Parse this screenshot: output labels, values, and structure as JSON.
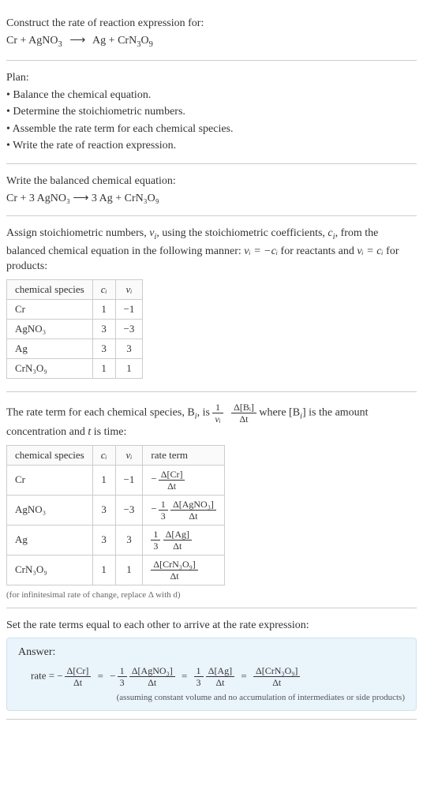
{
  "problem": {
    "title": "Construct the rate of reaction expression for:",
    "equation_lhs_1": "Cr",
    "equation_plus": "+",
    "equation_lhs_2": "AgNO",
    "equation_lhs_2_sub": "3",
    "arrow": "⟶",
    "equation_rhs_1": "Ag",
    "equation_rhs_2": "CrN",
    "equation_rhs_2_sub1": "3",
    "equation_rhs_2_mid": "O",
    "equation_rhs_2_sub2": "9"
  },
  "plan": {
    "heading": "Plan:",
    "items": [
      "• Balance the chemical equation.",
      "• Determine the stoichiometric numbers.",
      "• Assemble the rate term for each chemical species.",
      "• Write the rate of reaction expression."
    ]
  },
  "balanced": {
    "heading": "Write the balanced chemical equation:",
    "eq": "Cr + 3 AgNO₃ ⟶ 3 Ag + CrN₃O₉"
  },
  "assign": {
    "text_a": "Assign stoichiometric numbers, ",
    "nu": "ν",
    "sub_i": "i",
    "text_b": ", using the stoichiometric coefficients, ",
    "c": "c",
    "text_c": ", from the balanced chemical equation in the following manner: ",
    "rel1": "νᵢ = −cᵢ",
    "text_d": " for reactants and ",
    "rel2": "νᵢ = cᵢ",
    "text_e": " for products:"
  },
  "table1": {
    "headers": {
      "species": "chemical species",
      "ci": "cᵢ",
      "nui": "νᵢ"
    },
    "rows": [
      {
        "species": "Cr",
        "ci": "1",
        "nui": "−1"
      },
      {
        "species": "AgNO₃",
        "ci": "3",
        "nui": "−3"
      },
      {
        "species": "Ag",
        "ci": "3",
        "nui": "3"
      },
      {
        "species": "CrN₃O₉",
        "ci": "1",
        "nui": "1"
      }
    ]
  },
  "rateterm": {
    "text_a": "The rate term for each chemical species, B",
    "text_b": ", is ",
    "one": "1",
    "nu_i": "νᵢ",
    "dBi_num": "Δ[Bᵢ]",
    "dBi_den": "Δt",
    "text_c": " where [B",
    "text_d": "] is the amount concentration and ",
    "t": "t",
    "text_e": " is time:"
  },
  "table2": {
    "headers": {
      "species": "chemical species",
      "ci": "cᵢ",
      "nui": "νᵢ",
      "rate": "rate term"
    },
    "rows": [
      {
        "species": "Cr",
        "ci": "1",
        "nui": "−1",
        "sign": "−",
        "coef_num": "",
        "coef_den": "",
        "d_num": "Δ[Cr]",
        "d_den": "Δt"
      },
      {
        "species": "AgNO₃",
        "ci": "3",
        "nui": "−3",
        "sign": "−",
        "coef_num": "1",
        "coef_den": "3",
        "d_num": "Δ[AgNO₃]",
        "d_den": "Δt"
      },
      {
        "species": "Ag",
        "ci": "3",
        "nui": "3",
        "sign": "",
        "coef_num": "1",
        "coef_den": "3",
        "d_num": "Δ[Ag]",
        "d_den": "Δt"
      },
      {
        "species": "CrN₃O₉",
        "ci": "1",
        "nui": "1",
        "sign": "",
        "coef_num": "",
        "coef_den": "",
        "d_num": "Δ[CrN₃O₉]",
        "d_den": "Δt"
      }
    ]
  },
  "note": "(for infinitesimal rate of change, replace Δ with d)",
  "final_heading": "Set the rate terms equal to each other to arrive at the rate expression:",
  "answer": {
    "label": "Answer:",
    "rate_prefix": "rate = ",
    "terms": [
      {
        "sign": "−",
        "coef_num": "",
        "coef_den": "",
        "d_num": "Δ[Cr]",
        "d_den": "Δt"
      },
      {
        "sign": "−",
        "coef_num": "1",
        "coef_den": "3",
        "d_num": "Δ[AgNO₃]",
        "d_den": "Δt"
      },
      {
        "sign": "",
        "coef_num": "1",
        "coef_den": "3",
        "d_num": "Δ[Ag]",
        "d_den": "Δt"
      },
      {
        "sign": "",
        "coef_num": "",
        "coef_den": "",
        "d_num": "Δ[CrN₃O₉]",
        "d_den": "Δt"
      }
    ],
    "assume": "(assuming constant volume and no accumulation of intermediates or side products)"
  }
}
